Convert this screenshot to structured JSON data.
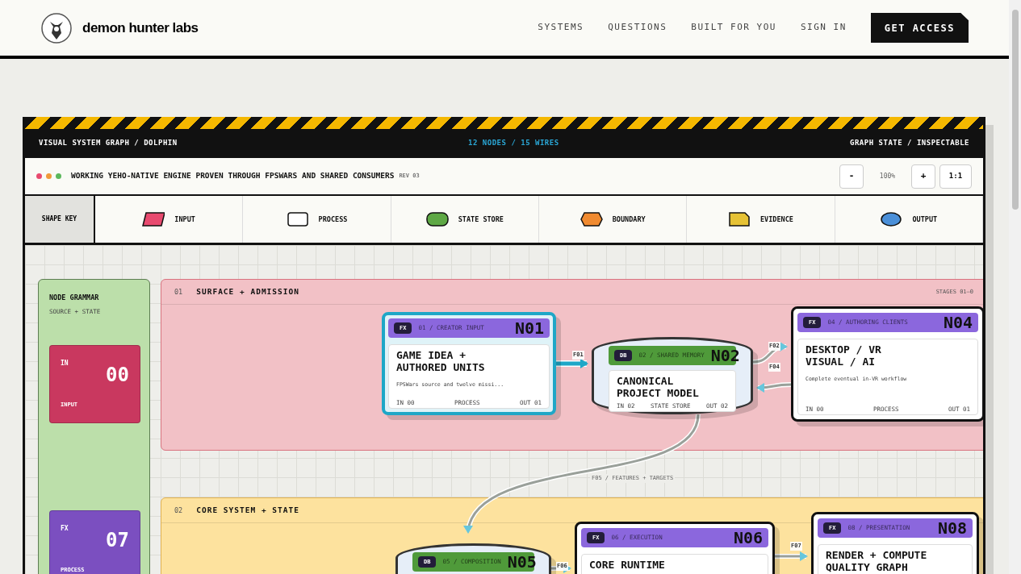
{
  "header": {
    "brand": "demon hunter labs",
    "nav": [
      "SYSTEMS",
      "QUESTIONS",
      "BUILT FOR YOU",
      "SIGN IN"
    ],
    "cta": "GET ACCESS"
  },
  "graph": {
    "title": "VISUAL SYSTEM GRAPH / DOLPHIN",
    "counts": "12 NODES / 15 WIRES",
    "state": "GRAPH STATE / INSPECTABLE",
    "status_dots": [
      {
        "color": "#e84a6f"
      },
      {
        "color": "#f09a3a"
      },
      {
        "color": "#5cb85c"
      }
    ],
    "status_title": "WORKING YEHO-NATIVE ENGINE PROVEN THROUGH FPSWARS AND SHARED CONSUMERS",
    "rev": "REV 03",
    "zoom": {
      "minus": "-",
      "value": "100%",
      "plus": "+",
      "reset": "1:1"
    }
  },
  "shape_key": {
    "label": "SHAPE KEY",
    "items": [
      {
        "kind": "input",
        "label": "INPUT",
        "color": "#e84a6f"
      },
      {
        "kind": "process",
        "label": "PROCESS",
        "color": "#ffffff"
      },
      {
        "kind": "store",
        "label": "STATE STORE",
        "color": "#5ea845"
      },
      {
        "kind": "boundary",
        "label": "BOUNDARY",
        "color": "#f08a30"
      },
      {
        "kind": "evidence",
        "label": "EVIDENCE",
        "color": "#e6c235"
      },
      {
        "kind": "output",
        "label": "OUTPUT",
        "color": "#4a8fd8"
      }
    ]
  },
  "grammar": {
    "title": "NODE GRAMMAR",
    "subtitle": "SOURCE + STATE",
    "cards": [
      {
        "tag": "IN",
        "count": "00",
        "label": "INPUT",
        "color": "#c9385f"
      },
      {
        "tag": "FX",
        "count": "07",
        "label": "PROCESS",
        "color": "#7b4fc0"
      }
    ]
  },
  "stages": [
    {
      "number": "01",
      "title": "SURFACE + ADMISSION",
      "range": "STAGES 01–0",
      "color": "#f2c1c6"
    },
    {
      "number": "02",
      "title": "CORE SYSTEM + STATE",
      "color": "#fde29e"
    }
  ],
  "nodes": [
    {
      "kind": "fx",
      "badge": "FX",
      "meta": "01 / CREATOR INPUT",
      "id": "N01",
      "title": "GAME IDEA +\nAUTHORED UNITS",
      "description": "FPSWars source and twelve missi...",
      "footer": [
        "IN 00",
        "PROCESS",
        "OUT 01"
      ],
      "selected": true
    },
    {
      "kind": "db",
      "badge": "DB",
      "meta": "02 / SHARED MEMORY",
      "id": "N02",
      "title": "CANONICAL\nPROJECT MODEL",
      "footer": [
        "IN 02",
        "STATE STORE",
        "OUT 02"
      ],
      "selected": false
    },
    {
      "kind": "fx",
      "badge": "FX",
      "meta": "04 / AUTHORING CLIENTS",
      "id": "N04",
      "title": "DESKTOP / VR\nVISUAL / AI",
      "description": "Complete eventual in-VR workflow",
      "footer": [
        "IN 00",
        "PROCESS",
        "OUT 01"
      ],
      "selected": false
    },
    {
      "kind": "db",
      "badge": "DB",
      "meta": "05 / COMPOSITION",
      "id": "N05",
      "selected": false
    },
    {
      "kind": "fx",
      "badge": "FX",
      "meta": "06 / EXECUTION",
      "id": "N06",
      "title": "CORE RUNTIME",
      "selected": false
    },
    {
      "kind": "fx",
      "badge": "FX",
      "meta": "08 / PRESENTATION",
      "id": "N08",
      "title": "RENDER + COMPUTE\nQUALITY GRAPH",
      "selected": false
    }
  ],
  "wires": [
    {
      "label": "F01",
      "highlighted": true
    },
    {
      "label": "F02",
      "highlighted": false
    },
    {
      "label": "F04",
      "highlighted": false
    },
    {
      "label": "F05 / FEATURES + TARGETS",
      "highlighted": false
    },
    {
      "label": "F06",
      "highlighted": false
    },
    {
      "label": "F07",
      "highlighted": false
    }
  ]
}
